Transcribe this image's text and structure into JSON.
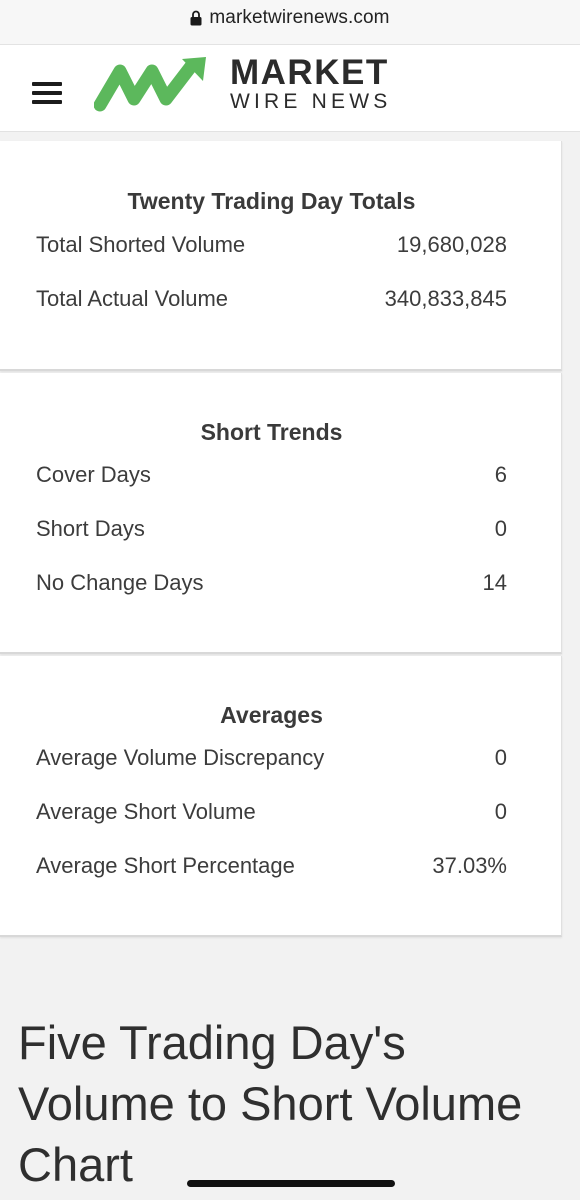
{
  "browser": {
    "url": "marketwirenews.com",
    "lock_icon": "lock-icon"
  },
  "header": {
    "menu_icon": "hamburger-menu-icon",
    "logo_line1": "MARKET",
    "logo_line2": "WIRE NEWS",
    "logo_color": "#5cb85c"
  },
  "twenty_day": {
    "title": "Twenty Trading Day Totals",
    "rows": [
      {
        "label": "Total Shorted Volume",
        "value": "19,680,028"
      },
      {
        "label": "Total Actual Volume",
        "value": "340,833,845"
      }
    ]
  },
  "short_trends": {
    "title": "Short Trends",
    "rows": [
      {
        "label": "Cover Days",
        "value": "6"
      },
      {
        "label": "Short Days",
        "value": "0"
      },
      {
        "label": "No Change Days",
        "value": "14"
      }
    ]
  },
  "averages": {
    "title": "Averages",
    "rows": [
      {
        "label": "Average Volume Discrepancy",
        "value": "0"
      },
      {
        "label": "Average Short Volume",
        "value": "0"
      },
      {
        "label": "Average Short Percentage",
        "value": "37.03%"
      }
    ]
  },
  "section_heading": "Five Trading Day's Volume to Short Volume Chart"
}
